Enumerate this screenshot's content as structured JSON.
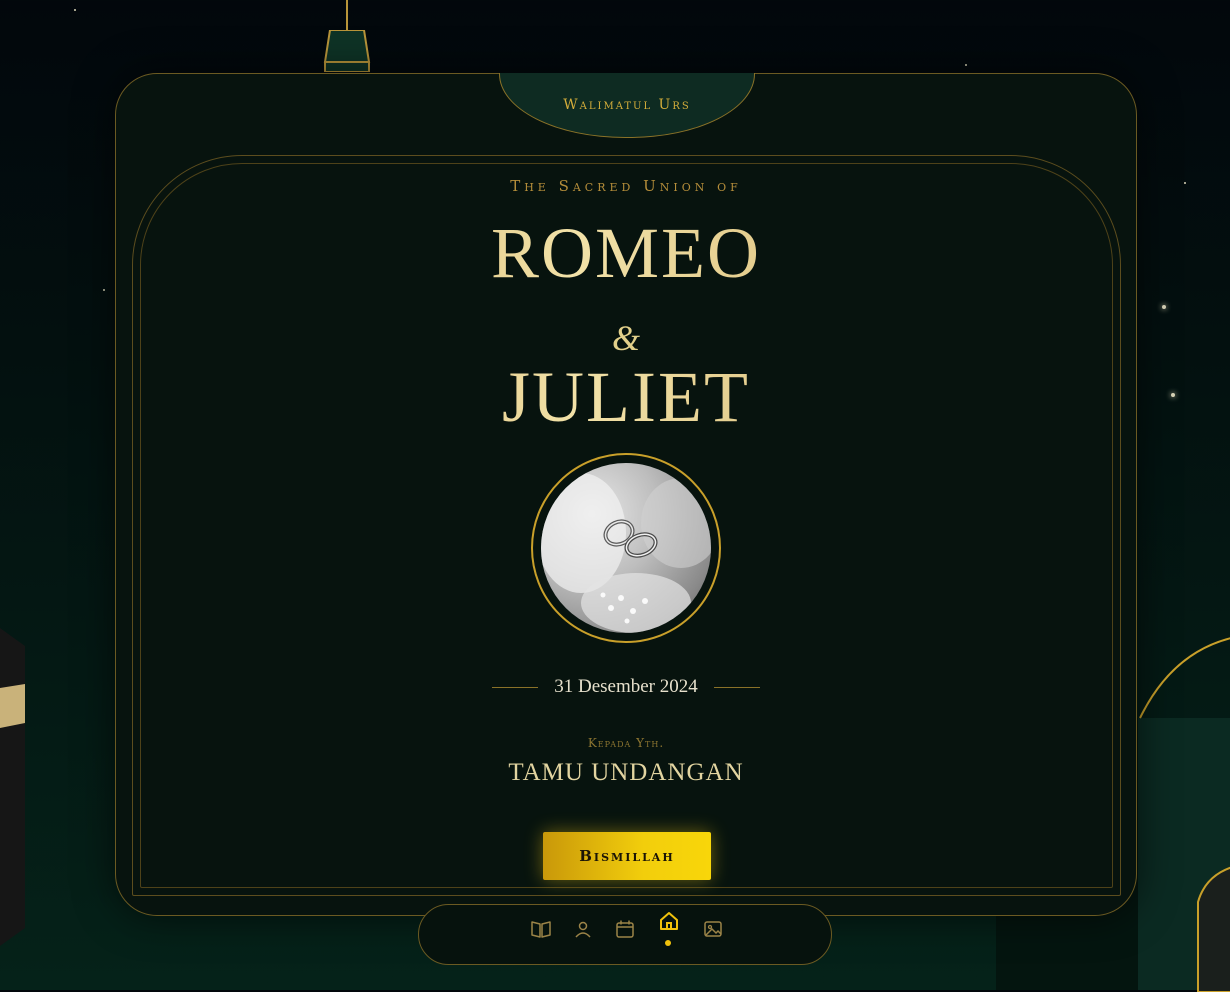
{
  "header": {
    "tab_label": "Walimatul Urs"
  },
  "hero": {
    "subtitle": "The Sacred Union of",
    "groom": "ROMEO",
    "ampersand": "&",
    "bride": "JULIET",
    "date": "31 Desember 2024"
  },
  "invite": {
    "to_label": "Kepada Yth.",
    "guest_name": "TAMU UNDANGAN",
    "button_label": "Bismillah"
  },
  "nav": {
    "items": [
      {
        "icon": "book-open-icon"
      },
      {
        "icon": "user-icon"
      },
      {
        "icon": "calendar-icon"
      },
      {
        "icon": "home-icon",
        "active": true
      },
      {
        "icon": "image-icon"
      }
    ]
  },
  "colors": {
    "gold": "#d4ad3a",
    "button_gold": "#f2ce0c",
    "background": "#03100f",
    "card": "#07130e"
  }
}
